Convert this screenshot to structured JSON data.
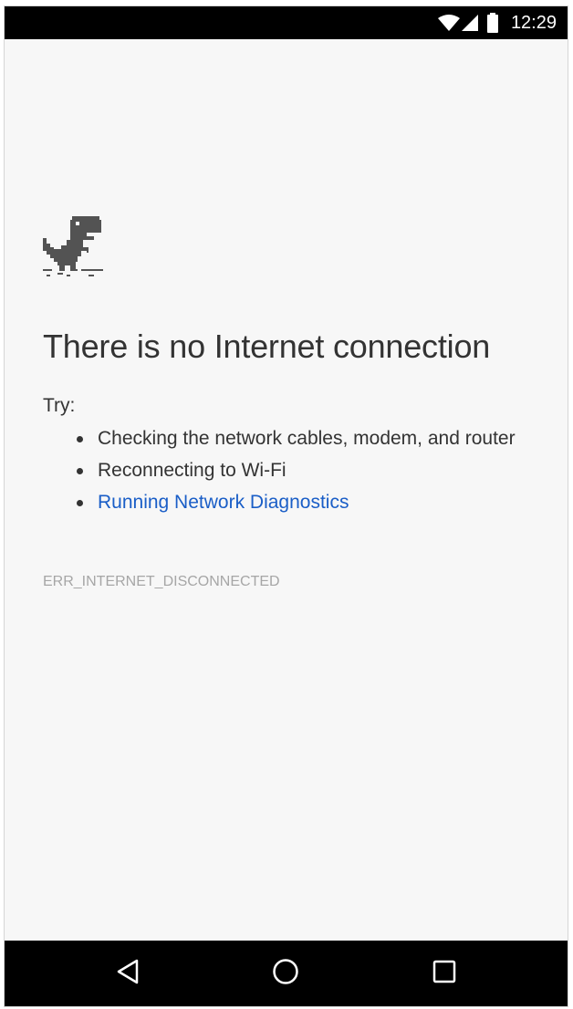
{
  "status_bar": {
    "time": "12:29",
    "icons": [
      "wifi-icon",
      "cell-signal-icon",
      "battery-icon"
    ]
  },
  "error_page": {
    "illustration": "offline-dinosaur-icon",
    "heading": "There is no Internet connection",
    "try_label": "Try:",
    "suggestions": [
      "Checking the network cables, modem, and router",
      "Reconnecting to Wi-Fi"
    ],
    "diagnostics_link": "Running Network Diagnostics",
    "error_code": "ERR_INTERNET_DISCONNECTED"
  },
  "nav_bar": {
    "buttons": [
      "back-icon",
      "home-icon",
      "recents-icon"
    ]
  },
  "colors": {
    "status_bar": "#000000",
    "page_background": "#f7f7f7",
    "text": "#333333",
    "link": "#1a5ec7",
    "error_code": "#a6a6a6"
  }
}
